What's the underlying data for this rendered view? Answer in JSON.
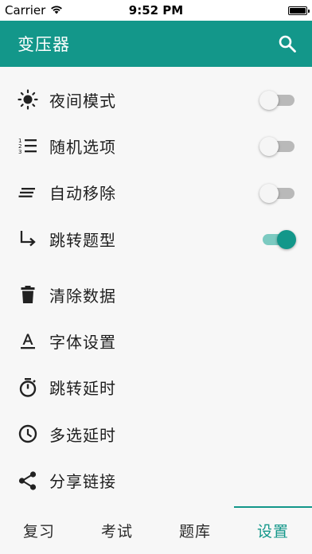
{
  "status_bar": {
    "carrier": "Carrier",
    "time": "9:52 PM"
  },
  "app_bar": {
    "title": "变压器",
    "search_icon": "search-icon"
  },
  "colors": {
    "primary": "#13978a",
    "toggle_on_track": "#7ccac1",
    "toggle_off_track": "#b9b9b9"
  },
  "settings": {
    "night_mode": {
      "label": "夜间模式",
      "icon": "brightness-icon",
      "enabled": false
    },
    "random_options": {
      "label": "随机选项",
      "icon": "numbered-list-icon",
      "enabled": false
    },
    "auto_remove": {
      "label": "自动移除",
      "icon": "lines-icon",
      "enabled": false
    },
    "jump_question_type": {
      "label": "跳转题型",
      "icon": "turn-arrow-icon",
      "enabled": true
    },
    "clear_data": {
      "label": "清除数据",
      "icon": "trash-icon"
    },
    "font_settings": {
      "label": "字体设置",
      "icon": "text-format-icon"
    },
    "jump_delay": {
      "label": "跳转延时",
      "icon": "timer-icon"
    },
    "multi_select_delay": {
      "label": "多选延时",
      "icon": "clock-icon"
    },
    "share_link": {
      "label": "分享链接",
      "icon": "share-icon"
    }
  },
  "tabs": [
    {
      "label": "复习",
      "active": false
    },
    {
      "label": "考试",
      "active": false
    },
    {
      "label": "题库",
      "active": false
    },
    {
      "label": "设置",
      "active": true
    }
  ]
}
